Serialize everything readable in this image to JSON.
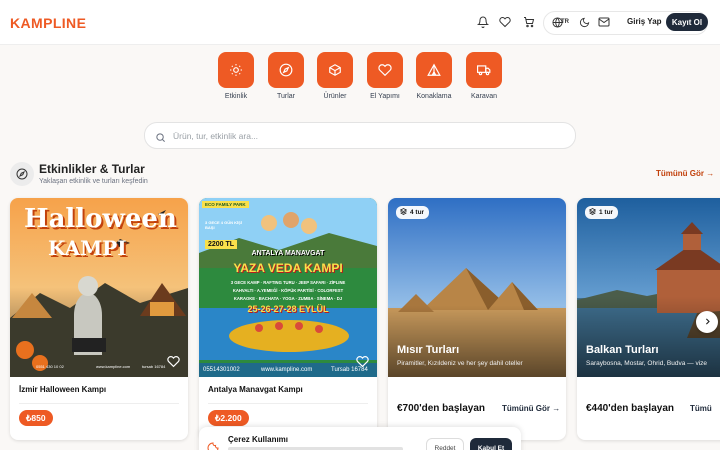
{
  "header": {
    "logo": "KAMPLINE",
    "lang": "TR",
    "login": "Giriş Yap",
    "signup": "Kayıt Ol"
  },
  "categories": [
    {
      "label": "Etkinlik",
      "icon": "sun-icon"
    },
    {
      "label": "Turlar",
      "icon": "compass-icon"
    },
    {
      "label": "Ürünler",
      "icon": "box-icon"
    },
    {
      "label": "El Yapımı",
      "icon": "heart-icon"
    },
    {
      "label": "Konaklama",
      "icon": "tent-icon"
    },
    {
      "label": "Karavan",
      "icon": "truck-icon"
    }
  ],
  "search": {
    "placeholder": "Ürün, tur, etkinlik ara..."
  },
  "section": {
    "title": "Etkinlikler & Turlar",
    "subtitle": "Yaklaşan etkinlik ve turları keşfedin",
    "see_all": "Tümünü Gör →"
  },
  "cards": [
    {
      "title": "İzmir Halloween Kampı",
      "price": "₺850",
      "poster_title_1": "Halloween",
      "poster_title_2": "KAMPI",
      "poster_phone": "0551 430 10 02",
      "poster_site": "www.kampline.com",
      "poster_license": "tursab 16784"
    },
    {
      "title": "Antalya Manavgat Kampı",
      "price": "₺2.200",
      "poster_brand": "ECO FAMILY PARK",
      "poster_offer": "3 GECE 4 GÜN KİŞİ BAŞI",
      "poster_price": "2200 TL",
      "poster_sub": "ANTALYA MANAVGAT",
      "poster_title": "YAZA VEDA KAMPI",
      "poster_line1": "3 GECE KAMP · RAFTING TURU · JEEP SAFARI · ZİPLINE",
      "poster_line2": "KAHVALTI · A.YEMEĞİ · KÖPÜK PARTİSİ · COLORFEST",
      "poster_line3": "KARAOKE · BACHATA · YOGA · ZUMBA · SİNEMA · DJ",
      "poster_dates": "25-26-27-28 EYLÜL",
      "poster_phone": "05514301002",
      "poster_site": "www.kampline.com",
      "poster_license": "Tursab 16784"
    },
    {
      "badge": "4 tur",
      "title": "Mısır Turları",
      "desc": "Piramitler, Kızıldeniz ve her şey dahil oteller",
      "price": "€700'den başlayan",
      "link": "Tümünü Gör →"
    },
    {
      "badge": "1 tur",
      "title": "Balkan Turları",
      "desc": "Saraybosna, Mostar, Ohrid, Budva — vize",
      "price": "€440'den başlayan",
      "link": "Tümü"
    }
  ],
  "cookie": {
    "title": "Çerez Kullanımı",
    "reject": "Reddet",
    "accept": "Kabul Et"
  },
  "colors": {
    "brand": "#ee5a24",
    "dark": "#1f2a3a",
    "background": "#faf8f6"
  }
}
